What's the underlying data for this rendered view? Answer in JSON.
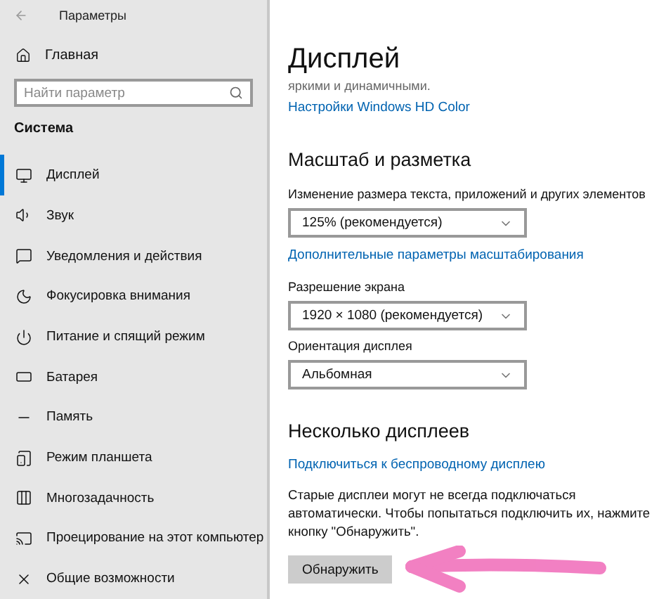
{
  "window": {
    "title": "Параметры"
  },
  "sidebar": {
    "home": "Главная",
    "search": {
      "placeholder": "Найти параметр"
    },
    "section": "Система",
    "items": [
      {
        "label": "Дисплей",
        "selected": true
      },
      {
        "label": "Звук",
        "selected": false
      },
      {
        "label": "Уведомления и действия",
        "selected": false
      },
      {
        "label": "Фокусировка внимания",
        "selected": false
      },
      {
        "label": "Питание и спящий режим",
        "selected": false
      },
      {
        "label": "Батарея",
        "selected": false
      },
      {
        "label": "Память",
        "selected": false
      },
      {
        "label": "Режим планшета",
        "selected": false
      },
      {
        "label": "Многозадачность",
        "selected": false
      },
      {
        "label": "Проецирование на этот компьютер",
        "selected": false
      },
      {
        "label": "Общие возможности",
        "selected": false
      }
    ]
  },
  "main": {
    "title": "Дисплей",
    "intro": "яркими и динамичными.",
    "hd_link": "Настройки Windows HD Color",
    "scale_section": {
      "heading": "Масштаб и разметка",
      "fields": [
        {
          "label": "Изменение размера текста, приложений и других элементов",
          "value": "125% (рекомендуется)",
          "link": "Дополнительные параметры масштабирования"
        },
        {
          "label": "Разрешение экрана",
          "value": "1920 × 1080 (рекомендуется)"
        },
        {
          "label": "Ориентация дисплея",
          "value": "Альбомная"
        }
      ]
    },
    "multi_section": {
      "heading": "Несколько дисплеев",
      "link": "Подключиться к беспроводному дисплею",
      "text": "Старые дисплеи могут не всегда подключаться автоматически. Чтобы попытаться подключить их, нажмите кнопку \"Обнаружить\".",
      "button": "Обнаружить"
    }
  }
}
